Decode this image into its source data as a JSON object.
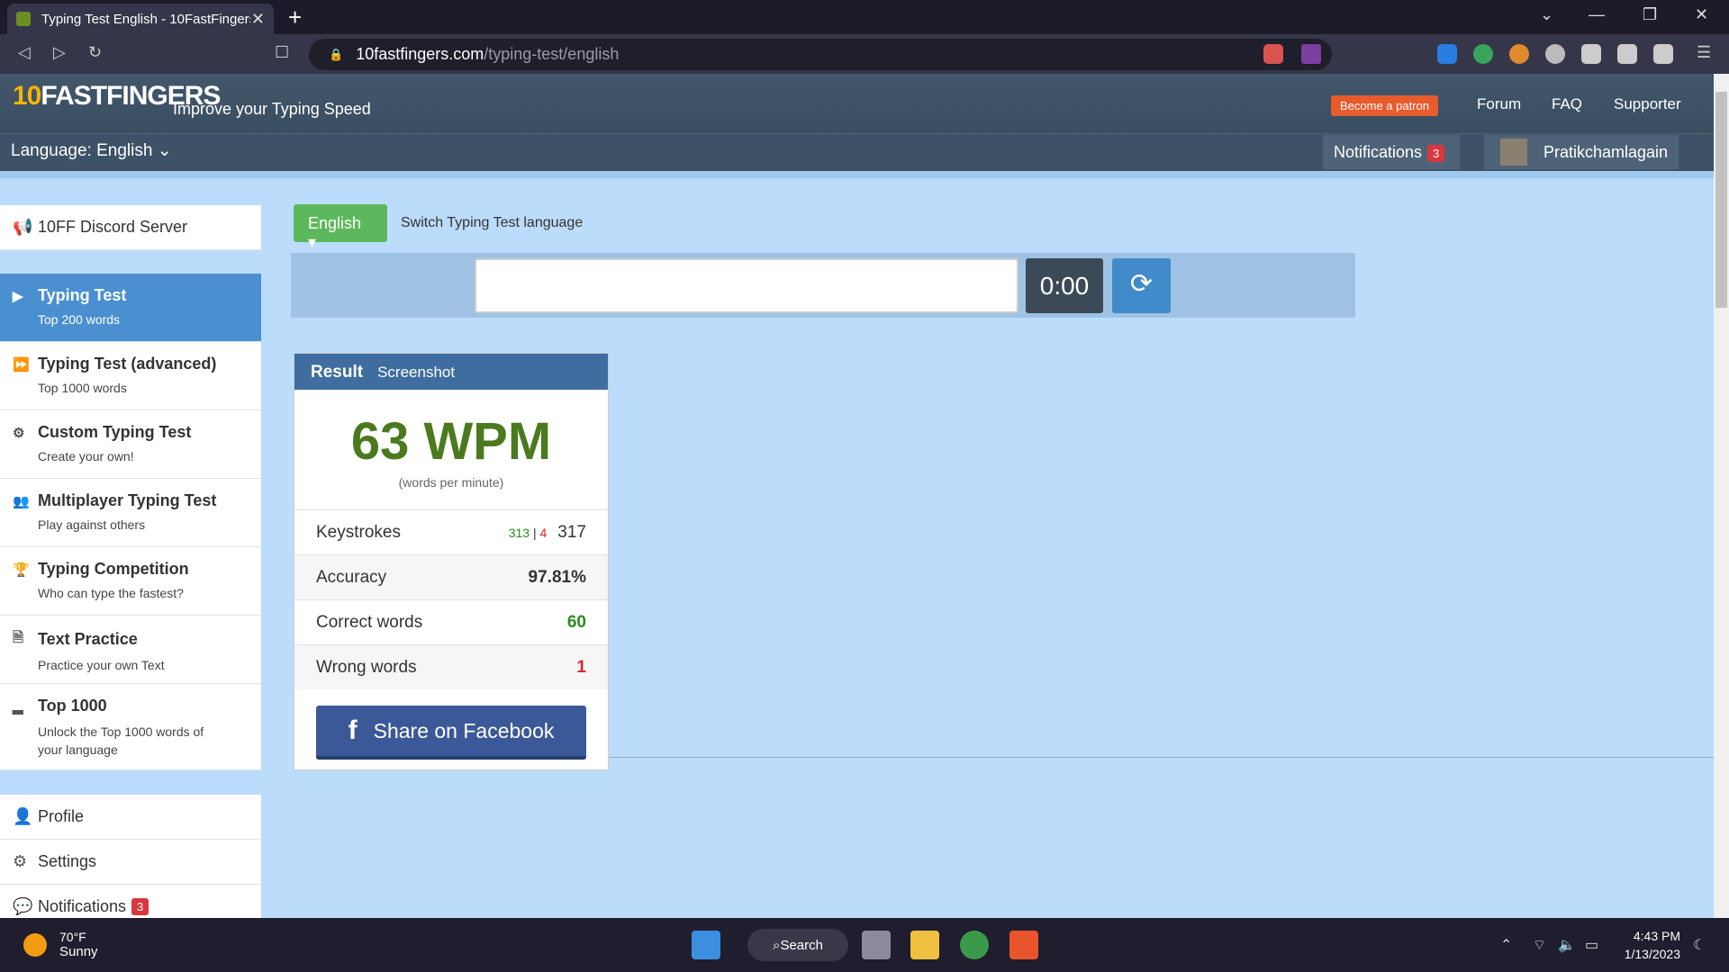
{
  "browser": {
    "tab_title": "Typing Test English - 10FastFingers",
    "new_tab": "+",
    "url_domain": "10fastfingers.com",
    "url_path": "/typing-test/english"
  },
  "site": {
    "logo_prefix": "10",
    "logo_text": "FASTFINGERS",
    "tagline": "Improve your Typing Speed",
    "patron": "Become a patron",
    "nav": [
      "Forum",
      "FAQ",
      "Supporter"
    ],
    "language_label": "Language: English",
    "notifications_label": "Notifications",
    "notifications_count": "3",
    "username": "Pratikchamlagain"
  },
  "sidebar": {
    "discord": "10FF Discord Server",
    "items": [
      {
        "title": "Typing Test",
        "sub": "Top 200 words",
        "icon": "play-icon"
      },
      {
        "title": "Typing Test (advanced)",
        "sub": "Top 1000 words",
        "icon": "fast-forward-icon"
      },
      {
        "title": "Custom Typing Test",
        "sub": "Create your own!",
        "icon": "gears-icon"
      },
      {
        "title": "Multiplayer Typing Test",
        "sub": "Play against others",
        "icon": "users-icon"
      },
      {
        "title": "Typing Competition",
        "sub": "Who can type the fastest?",
        "icon": "trophy-icon"
      },
      {
        "title": "Text Practice",
        "sub": "Practice your own Text",
        "icon": "document-icon"
      },
      {
        "title": "Top 1000",
        "sub": "Unlock the Top 1000 words of your language",
        "icon": "signal-icon"
      }
    ],
    "profile": "Profile",
    "settings": "Settings",
    "notifications": "Notifications",
    "notifications_count": "3"
  },
  "main": {
    "lang_button": "English",
    "switch_label": "Switch Typing Test language",
    "timer": "0:00",
    "result_title": "Result",
    "result_tab": "Screenshot",
    "wpm": "63 WPM",
    "wpm_sub": "(words per minute)",
    "keystrokes_label": "Keystrokes",
    "keystrokes_correct": "313",
    "keystrokes_sep": "|",
    "keystrokes_wrong": "4",
    "keystrokes_total": "317",
    "accuracy_label": "Accuracy",
    "accuracy": "97.81%",
    "correct_label": "Correct words",
    "correct": "60",
    "wrong_label": "Wrong words",
    "wrong": "1",
    "facebook": "Share on Facebook"
  },
  "taskbar": {
    "temp": "70°F",
    "weather": "Sunny",
    "search": "Search",
    "time": "4:43 PM",
    "date": "1/13/2023"
  },
  "colors": {
    "accent": "#4a90d0",
    "wpm_green": "#4b7a1e",
    "header": "#43576b",
    "facebook": "#3b5998"
  }
}
